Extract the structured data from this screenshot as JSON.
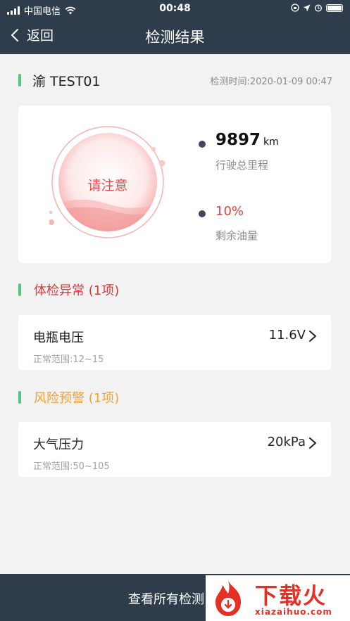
{
  "status_bar": {
    "carrier": "中国电信",
    "time": "00:48"
  },
  "nav": {
    "back_label": "返回",
    "title": "检测结果"
  },
  "vehicle": {
    "plate": "渝 TEST01",
    "check_time": "检测时间:2020-01-09 00:47"
  },
  "summary": {
    "status": "请注意",
    "mileage": {
      "value": "9897",
      "unit": "km",
      "label": "行驶总里程"
    },
    "fuel": {
      "value": "10%",
      "label": "剩余油量"
    }
  },
  "sections": [
    {
      "title": "体检异常 (1项)",
      "color": "#d93a3a",
      "items": [
        {
          "name": "电瓶电压",
          "value": "11.6V",
          "range": "正常范围:12~15"
        }
      ]
    },
    {
      "title": "风险预警 (1项)",
      "color": "#f0a235",
      "items": [
        {
          "name": "大气压力",
          "value": "20kPa",
          "range": "正常范围:50~105"
        }
      ]
    }
  ],
  "bottom": {
    "button_label": "查看所有检测"
  },
  "watermark": {
    "text": "下载火",
    "url": "xiazaihuo.com"
  },
  "colors": {
    "header_bg": "#2f3c4c",
    "accent_green": "#4cc97a",
    "danger": "#d93a3a",
    "warning": "#f0a235"
  }
}
